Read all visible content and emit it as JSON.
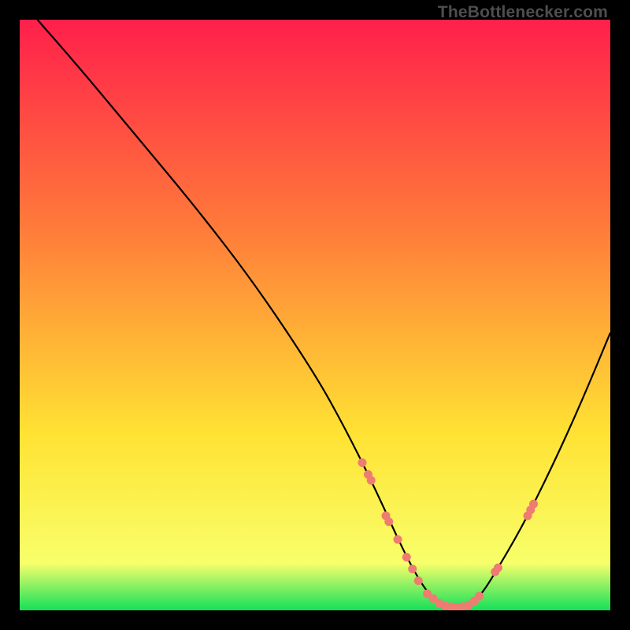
{
  "watermark": "TheBottlenecker.com",
  "colors": {
    "gradient_top": "#ff1f4b",
    "gradient_mid1": "#ff7a3a",
    "gradient_mid2": "#ffe233",
    "gradient_low": "#f8ff6a",
    "gradient_bottom": "#15e05a",
    "curve": "#000000",
    "marker": "#ef7c72",
    "frame_bg": "#000000"
  },
  "chart_data": {
    "type": "line",
    "title": "",
    "xlabel": "",
    "ylabel": "",
    "xlim": [
      0,
      100
    ],
    "ylim": [
      0,
      100
    ],
    "grid": false,
    "legend": false,
    "series": [
      {
        "name": "bottleneck-curve",
        "x": [
          3,
          10,
          20,
          30,
          40,
          50,
          55,
          60,
          65,
          68,
          70,
          72,
          74,
          76,
          78,
          80,
          85,
          90,
          95,
          100
        ],
        "y": [
          100,
          92,
          80,
          68,
          55,
          40,
          31,
          21,
          10,
          4.5,
          2,
          0.8,
          0.5,
          0.8,
          2.5,
          5.5,
          14,
          24,
          35,
          47
        ]
      }
    ],
    "markers": [
      {
        "name": "cluster-left",
        "points": [
          {
            "x": 58,
            "y": 25
          },
          {
            "x": 59,
            "y": 23
          },
          {
            "x": 59.5,
            "y": 22
          },
          {
            "x": 62,
            "y": 16
          },
          {
            "x": 62.5,
            "y": 15
          },
          {
            "x": 64,
            "y": 12
          },
          {
            "x": 65.5,
            "y": 9
          },
          {
            "x": 66.5,
            "y": 7
          },
          {
            "x": 67.5,
            "y": 5
          }
        ]
      },
      {
        "name": "cluster-valley",
        "points": [
          {
            "x": 69,
            "y": 2.8
          },
          {
            "x": 70,
            "y": 2
          },
          {
            "x": 71,
            "y": 1.2
          },
          {
            "x": 72,
            "y": 0.8
          },
          {
            "x": 73,
            "y": 0.6
          },
          {
            "x": 74,
            "y": 0.5
          },
          {
            "x": 75,
            "y": 0.6
          },
          {
            "x": 76,
            "y": 0.9
          },
          {
            "x": 77,
            "y": 1.6
          },
          {
            "x": 77.8,
            "y": 2.4
          }
        ]
      },
      {
        "name": "cluster-right",
        "points": [
          {
            "x": 80.5,
            "y": 6.5
          },
          {
            "x": 81,
            "y": 7.2
          },
          {
            "x": 86,
            "y": 16
          },
          {
            "x": 86.5,
            "y": 17
          },
          {
            "x": 87,
            "y": 18
          }
        ]
      }
    ]
  }
}
